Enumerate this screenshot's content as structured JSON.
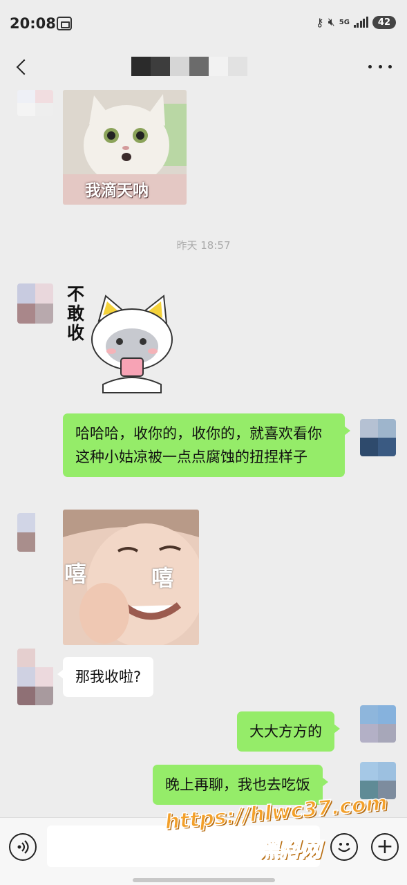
{
  "status_bar": {
    "time": "20:08",
    "network": "5G",
    "battery": "42"
  },
  "header": {
    "back_icon": "chevron-left-icon",
    "more_icon": "ellipsis-icon",
    "name_pixel_colors": [
      "#2b2b2b",
      "#3d3d3d",
      "#d6d6d6",
      "#6b6b6b",
      "#ededed",
      "#e2e2e2"
    ]
  },
  "chat": {
    "timestamp": "昨天 18:57",
    "messages": [
      {
        "sender": "them",
        "type": "sticker",
        "caption": "我滴天呐"
      },
      {
        "sender": "them",
        "type": "sticker",
        "caption": "不\n敢\n收"
      },
      {
        "sender": "me",
        "type": "text",
        "text": "哈哈哈，收你的，收你的，就喜欢看你这种小姑凉被一点点腐蚀的扭捏样子"
      },
      {
        "sender": "them",
        "type": "sticker",
        "caption_left": "嘻",
        "caption_right": "嘻"
      },
      {
        "sender": "them",
        "type": "text",
        "text": "那我收啦?"
      },
      {
        "sender": "me",
        "type": "text",
        "text": "大大方方的"
      },
      {
        "sender": "me",
        "type": "text",
        "text": "晚上再聊，我也去吃饭"
      }
    ]
  },
  "input_bar": {
    "voice_icon": "voice-icon",
    "emoji_icon": "emoji-icon",
    "plus_icon": "plus-icon",
    "input_value": ""
  },
  "watermark": {
    "url": "https://hlwc37.com",
    "brand": "黑料网"
  },
  "colors": {
    "my_bubble": "#95ec69",
    "their_bubble": "#ffffff",
    "background": "#ededed",
    "watermark": "#f3a02a"
  }
}
